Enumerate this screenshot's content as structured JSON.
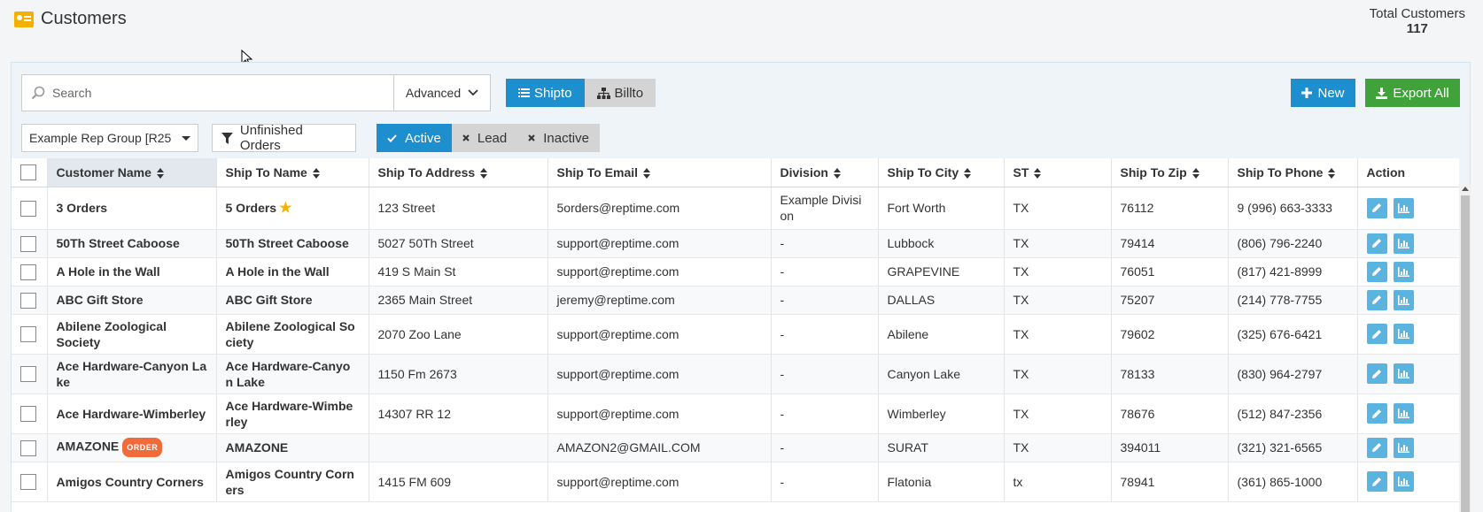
{
  "page": {
    "title": "Customers",
    "title_icon": "contact-card-icon"
  },
  "total": {
    "label": "Total Customers",
    "count": "117"
  },
  "toolbar": {
    "search_placeholder": "Search",
    "advanced_label": "Advanced",
    "shipto_label": "Shipto",
    "billto_label": "Billto",
    "new_label": "New",
    "export_label": "Export All"
  },
  "filters": {
    "rep_group": "Example Rep Group [R25",
    "unfinished_label": "Unfinished Orders",
    "active_label": "Active",
    "lead_label": "Lead",
    "inactive_label": "Inactive"
  },
  "colors": {
    "primary": "#1d8fcf",
    "success": "#3fa33a",
    "action": "#5bb3e0",
    "badge": "#f06a3a",
    "star": "#f2b400"
  },
  "table": {
    "columns": [
      "Customer Name",
      "Ship To Name",
      "Ship To Address",
      "Ship To Email",
      "Division",
      "Ship To City",
      "ST",
      "Ship To Zip",
      "Ship To Phone",
      "Action"
    ],
    "rows": [
      {
        "customer": "3 Orders",
        "badge": "",
        "shipto": "5 Orders",
        "star": true,
        "address": "123 Street",
        "email": "5orders@reptime.com",
        "division": "Example Divisi on",
        "city": "Fort Worth",
        "st": "TX",
        "zip": "76112",
        "phone": "9 (996) 663-3333"
      },
      {
        "customer": "50Th Street Caboose",
        "badge": "",
        "shipto": "50Th Street Caboose",
        "star": false,
        "address": "5027 50Th Street",
        "email": "support@reptime.com",
        "division": "-",
        "city": "Lubbock",
        "st": "TX",
        "zip": "79414",
        "phone": "(806) 796-2240"
      },
      {
        "customer": "A Hole in the Wall",
        "badge": "",
        "shipto": "A Hole in the Wall",
        "star": false,
        "address": "419 S Main St",
        "email": "support@reptime.com",
        "division": "-",
        "city": "GRAPEVINE",
        "st": "TX",
        "zip": "76051",
        "phone": "(817) 421-8999"
      },
      {
        "customer": "ABC Gift Store",
        "badge": "",
        "shipto": "ABC Gift Store",
        "star": false,
        "address": "2365 Main Street",
        "email": "jeremy@reptime.com",
        "division": "-",
        "city": "DALLAS",
        "st": "TX",
        "zip": "75207",
        "phone": "(214) 778-7755"
      },
      {
        "customer": "Abilene Zoological Society",
        "badge": "",
        "shipto": "Abilene Zoological So ciety",
        "star": false,
        "address": "2070 Zoo Lane",
        "email": "support@reptime.com",
        "division": "-",
        "city": "Abilene",
        "st": "TX",
        "zip": "79602",
        "phone": "(325) 676-6421"
      },
      {
        "customer": "Ace Hardware-Canyon La ke",
        "badge": "",
        "shipto": "Ace Hardware-Canyo n Lake",
        "star": false,
        "address": "1150 Fm 2673",
        "email": "support@reptime.com",
        "division": "-",
        "city": "Canyon Lake",
        "st": "TX",
        "zip": "78133",
        "phone": "(830) 964-2797"
      },
      {
        "customer": "Ace Hardware-Wimberley",
        "badge": "",
        "shipto": "Ace Hardware-Wimbe rley",
        "star": false,
        "address": "14307 RR 12",
        "email": "support@reptime.com",
        "division": "-",
        "city": "Wimberley",
        "st": "TX",
        "zip": "78676",
        "phone": "(512) 847-2356"
      },
      {
        "customer": "AMAZONE",
        "badge": "ORDER",
        "shipto": "AMAZONE",
        "star": false,
        "address": "",
        "email": "AMAZON2@GMAIL.COM",
        "division": "-",
        "city": "SURAT",
        "st": "TX",
        "zip": "394011",
        "phone": "(321) 321-6565"
      },
      {
        "customer": "Amigos Country Corners",
        "badge": "",
        "shipto": "Amigos Country Corn ers",
        "star": false,
        "address": "1415 FM 609",
        "email": "support@reptime.com",
        "division": "-",
        "city": "Flatonia",
        "st": "tx",
        "zip": "78941",
        "phone": "(361) 865-1000"
      }
    ]
  }
}
